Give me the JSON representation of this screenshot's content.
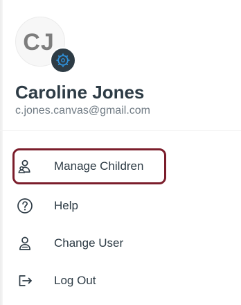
{
  "profile": {
    "initials": "CJ",
    "name": "Caroline Jones",
    "email": "c.jones.canvas@gmail.com",
    "badge_icon": "canvas-logo-icon"
  },
  "menu": {
    "items": [
      {
        "label": "Manage Children",
        "icon": "manage-children-icon",
        "selected": true
      },
      {
        "label": "Help",
        "icon": "help-icon",
        "selected": false
      },
      {
        "label": "Change User",
        "icon": "change-user-icon",
        "selected": false
      },
      {
        "label": "Log Out",
        "icon": "log-out-icon",
        "selected": false
      }
    ]
  },
  "colors": {
    "text_primary": "#2d3b45",
    "text_secondary": "#707b84",
    "highlight_border": "#7b1d2b",
    "badge_background": "#2d3b45",
    "badge_accent": "#2f8fd8"
  }
}
